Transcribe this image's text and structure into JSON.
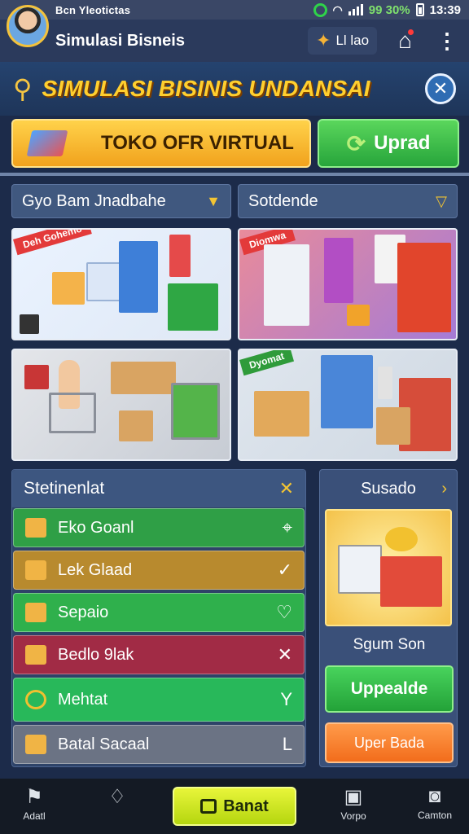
{
  "status_bar": {
    "left_text": "Bcn Yleotictas",
    "battery_pct": "99 30%",
    "time": "13:39"
  },
  "app_bar": {
    "title": "Simulasi Bisneis",
    "badge_text": "Ll lao"
  },
  "banner": {
    "title": "SIMULASI BISINIS UNDANSAI"
  },
  "actions": {
    "store_label": "TOKO OFR VIRTUAL",
    "upgrade_label": "Uprad"
  },
  "filters": {
    "left": "Gyo Bam Jnadbahe",
    "right": "Sotdende"
  },
  "tiles": [
    {
      "tag": "Deh Gohemo",
      "tag_color": "#e33a3a"
    },
    {
      "tag": "Diomwa",
      "tag_color": "#e33a3a"
    },
    {
      "tag": "",
      "tag_color": "#e33a3a"
    },
    {
      "tag": "Dyomat",
      "tag_color": "#2f9b3a"
    }
  ],
  "list": {
    "title": "Stetinenlat",
    "items": [
      {
        "label": "Eko Goanl",
        "icon": "box-icon",
        "right_icon": "tag-icon",
        "right_glyph": "⌖",
        "color": "#2f9f46"
      },
      {
        "label": "Lek Glaad",
        "icon": "box-icon",
        "right_icon": "check-icon",
        "right_glyph": "✓",
        "color": "#b88a2e"
      },
      {
        "label": "Sepaio",
        "icon": "box-icon",
        "right_icon": "diamond-icon",
        "right_glyph": "♡",
        "color": "#2fb04c"
      },
      {
        "label": "Bedlo 9lak",
        "icon": "box-icon",
        "right_icon": "close-icon",
        "right_glyph": "✕",
        "color": "#a12b45"
      },
      {
        "label": "Mehtat",
        "icon": "ring-icon",
        "right_icon": "shield-icon",
        "right_glyph": "Y",
        "color": "#28b85a"
      },
      {
        "label": "Batal Sacaal",
        "icon": "box-icon",
        "right_icon": "corner-icon",
        "right_glyph": "L",
        "color": "#6b7384"
      }
    ]
  },
  "side": {
    "title": "Susado",
    "name": "Sgum Son",
    "upgrade_label": "Uppealde",
    "secondary_label": "Uper Bada"
  },
  "bottom_nav": {
    "items": [
      {
        "label": "Adatl",
        "icon": "flag-icon"
      },
      {
        "label": "",
        "icon": "leaf-icon"
      },
      {
        "label": "Vorpo",
        "icon": "inbox-icon"
      },
      {
        "label": "Camton",
        "icon": "camera-icon"
      }
    ],
    "center_label": "Banat"
  }
}
